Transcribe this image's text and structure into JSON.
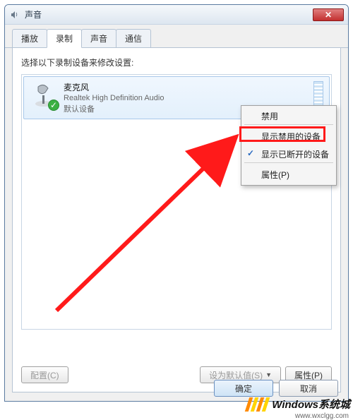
{
  "window": {
    "title": "声音",
    "close_glyph": "✕"
  },
  "tabs": [
    {
      "label": "播放"
    },
    {
      "label": "录制"
    },
    {
      "label": "声音"
    },
    {
      "label": "通信"
    }
  ],
  "active_tab_index": 1,
  "prompt": "选择以下录制设备来修改设置:",
  "device": {
    "name": "麦克风",
    "sub": "Realtek High Definition Audio",
    "status": "默认设备",
    "check_glyph": "✓"
  },
  "buttons": {
    "configure": "配置(C)",
    "set_default": "设为默认值(S)",
    "properties": "属性(P)",
    "ok": "确定",
    "cancel": "取消"
  },
  "context_menu": {
    "disable": "禁用",
    "show_disabled": "显示禁用的设备",
    "show_disconnected": "显示已断开的设备",
    "properties": "属性(P)",
    "check_glyph": "✓"
  },
  "watermark": {
    "text": "Windows系统城",
    "url": "www.wxclgg.com"
  },
  "colors": {
    "highlight": "#ff1a1a",
    "stripe_a": "#ff8a00",
    "stripe_b": "#ffd400"
  }
}
